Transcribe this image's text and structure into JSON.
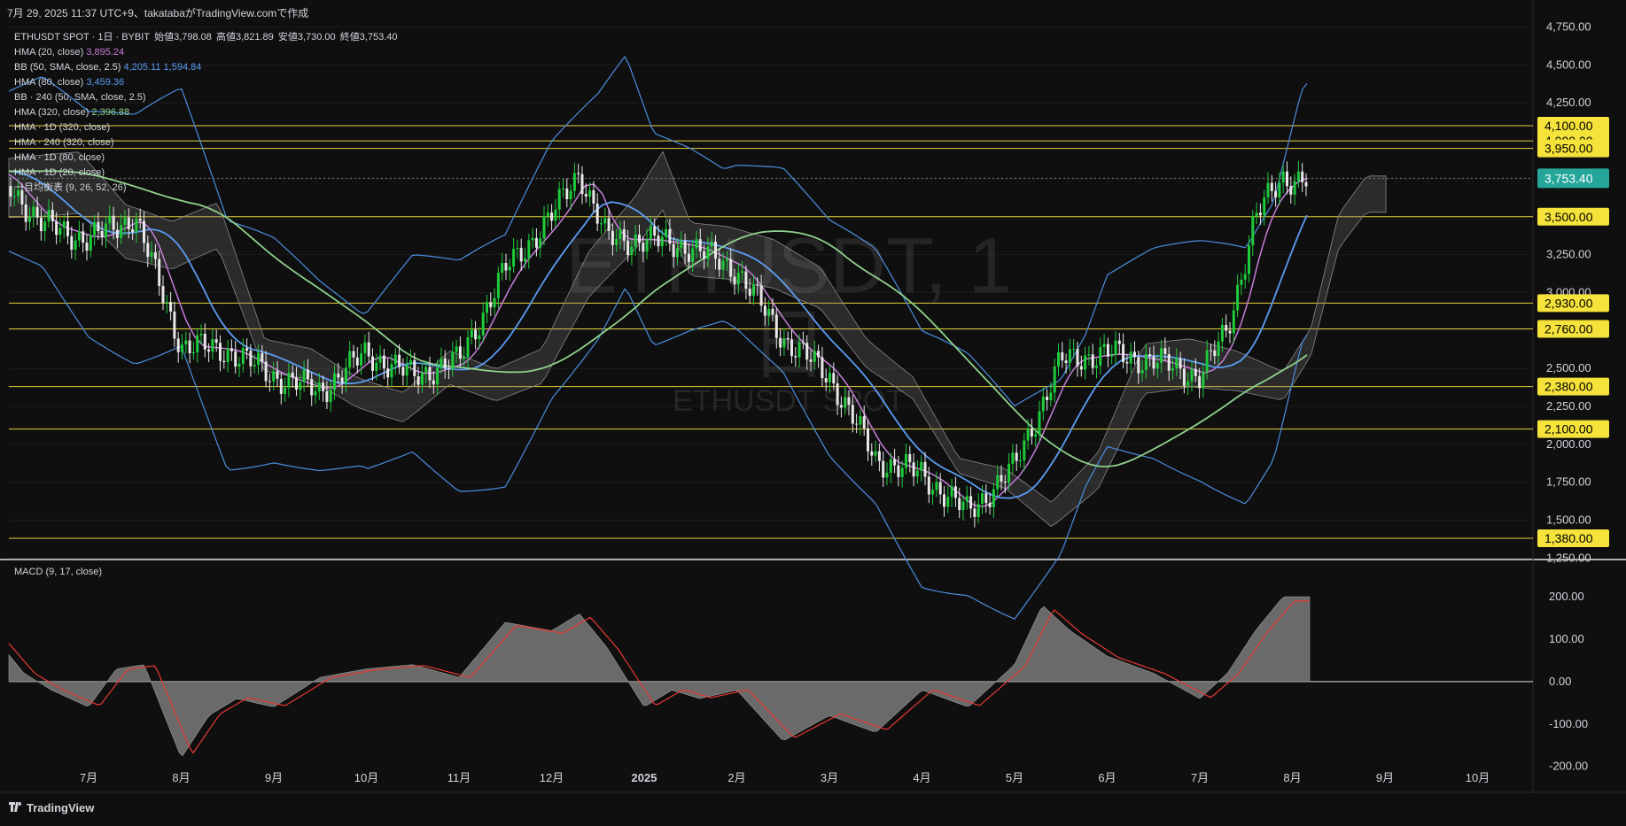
{
  "header": {
    "text": "7月 29, 2025 11:37 UTC+9、takatabaがTradingView.comで作成"
  },
  "watermark": {
    "title": "ETHUSDT, 1日",
    "subtitle": "ETHUSDT SPOT"
  },
  "legend": {
    "symbol": "ETHUSDT SPOT · 1日 · BYBIT",
    "ohlc": [
      {
        "label": "始値",
        "value": "3,798.08"
      },
      {
        "label": "高値",
        "value": "3,821.89"
      },
      {
        "label": "安値",
        "value": "3,730.00"
      },
      {
        "label": "終値",
        "value": "3,753.40"
      }
    ],
    "indicators": [
      {
        "label": "HMA (20, close)",
        "value": "3,895.24",
        "color": "#c77ddb"
      },
      {
        "label": "BB (50, SMA, close, 2.5)",
        "value": "4,205.11",
        "value2": "1,594.84",
        "color": "#5b9cf2"
      },
      {
        "label": "HMA (80, close)",
        "value": "3,459.36",
        "color": "#5b9cf2"
      },
      {
        "label": "BB · 240 (50, SMA, close, 2.5)",
        "value": "",
        "color": "#d1d4dc"
      },
      {
        "label": "HMA (320, close)",
        "value": "2,396.88",
        "color": "#8fd18b"
      },
      {
        "label": "HMA · 1D (320, close)",
        "value": "",
        "color": "#d1d4dc"
      },
      {
        "label": "HMA · 240 (320, close)",
        "value": "",
        "color": "#d1d4dc"
      },
      {
        "label": "HMA · 1D (80, close)",
        "value": "",
        "color": "#d1d4dc"
      },
      {
        "label": "HMA · 1D (20, close)",
        "value": "",
        "color": "#d1d4dc"
      },
      {
        "label": "一目均衡表 (9, 26, 52, 26)",
        "value": "",
        "color": "#d1d4dc"
      }
    ]
  },
  "macd": {
    "label": "MACD (9, 17, close)"
  },
  "footer": {
    "brand": "TradingView"
  },
  "chart_data": {
    "type": "candlestick",
    "price_axis": {
      "ticks": [
        "4,750.00",
        "4,500.00",
        "4,250.00",
        "4,000.00",
        "3,750.00",
        "3,500.00",
        "3,250.00",
        "3,000.00",
        "2,750.00",
        "2,500.00",
        "2,250.00",
        "2,000.00",
        "1,750.00",
        "1,500.00",
        "1,250.00"
      ],
      "tick_values": [
        4750,
        4500,
        4250,
        4000,
        3750,
        3500,
        3250,
        3000,
        2750,
        2500,
        2250,
        2000,
        1750,
        1500,
        1250
      ],
      "range": [
        1240,
        4800
      ]
    },
    "horizontal_levels": [
      {
        "value": 4100,
        "label": "4,100.00"
      },
      {
        "value": 4000,
        "label": "4,000.00"
      },
      {
        "value": 3950,
        "label": "3,950.00"
      },
      {
        "value": 3500,
        "label": "3,500.00"
      },
      {
        "value": 2930,
        "label": "2,930.00"
      },
      {
        "value": 2760,
        "label": "2,760.00"
      },
      {
        "value": 2380,
        "label": "2,380.00"
      },
      {
        "value": 2100,
        "label": "2,100.00"
      },
      {
        "value": 1380,
        "label": "1,380.00"
      }
    ],
    "last_price": {
      "value": 3753.4,
      "label": "3,753.40"
    },
    "time_axis": {
      "labels": [
        "7月",
        "8月",
        "9月",
        "10月",
        "11月",
        "12月",
        "2025",
        "2月",
        "3月",
        "4月",
        "5月",
        "6月",
        "7月",
        "8月",
        "9月",
        "10月"
      ],
      "months_index": [
        1,
        2,
        3,
        4,
        5,
        6,
        7,
        8,
        9,
        10,
        11,
        12,
        13,
        14,
        15,
        16
      ]
    },
    "close_series_monthly": {
      "month_index": [
        0,
        0.5,
        1,
        1.5,
        2,
        2.5,
        3,
        3.5,
        4,
        4.5,
        5,
        5.5,
        6,
        6.3,
        6.6,
        7,
        7.5,
        8,
        8.5,
        9,
        9.5,
        10,
        10.5,
        11,
        11.5,
        12,
        12.5,
        13,
        13.3,
        13.6,
        13.9
      ],
      "close": [
        3800,
        3450,
        3350,
        3500,
        2650,
        2620,
        2450,
        2350,
        2600,
        2450,
        2550,
        3150,
        3500,
        3800,
        3350,
        3350,
        3300,
        3150,
        2700,
        2450,
        1900,
        1800,
        1550,
        1850,
        2550,
        2600,
        2550,
        2450,
        2750,
        3500,
        3753
      ]
    },
    "macd_axis": {
      "ticks": [
        "200.00",
        "100.00",
        "0.00",
        "-100.00",
        "-200.00"
      ],
      "tick_values": [
        200,
        100,
        0,
        -100,
        -200
      ],
      "range": [
        -230,
        240
      ]
    },
    "macd_series": {
      "month_index": [
        0,
        0.3,
        0.6,
        1,
        1.3,
        1.6,
        2,
        2.3,
        2.6,
        3,
        3.5,
        4,
        4.5,
        5,
        5.5,
        6,
        6.3,
        6.6,
        7,
        7.3,
        7.6,
        8,
        8.5,
        9,
        9.5,
        10,
        10.5,
        11,
        11.3,
        11.6,
        12,
        12.5,
        13,
        13.3,
        13.6,
        13.9
      ],
      "histogram": [
        100,
        20,
        -20,
        -60,
        30,
        40,
        -180,
        -80,
        -40,
        -60,
        10,
        30,
        40,
        10,
        140,
        120,
        160,
        80,
        -60,
        -20,
        -40,
        -20,
        -140,
        -80,
        -120,
        -20,
        -60,
        40,
        180,
        120,
        60,
        20,
        -40,
        20,
        120,
        200
      ]
    }
  }
}
